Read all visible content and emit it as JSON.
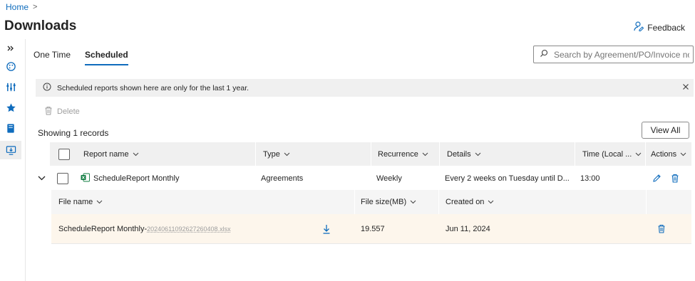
{
  "breadcrumb": {
    "home": "Home",
    "sep": ">"
  },
  "page": {
    "title": "Downloads"
  },
  "feedback": {
    "label": "Feedback"
  },
  "tabs": [
    {
      "label": "One Time"
    },
    {
      "label": "Scheduled"
    }
  ],
  "search": {
    "placeholder": "Search by Agreement/PO/Invoice no., ..."
  },
  "info": {
    "message": "Scheduled reports shown here are only for the last 1 year."
  },
  "toolbar": {
    "delete_label": "Delete",
    "records_label": "Showing 1 records",
    "view_all_label": "View All"
  },
  "grid": {
    "columns": {
      "report_name": "Report name",
      "type": "Type",
      "recurrence": "Recurrence",
      "details": "Details",
      "time": "Time (Local ...",
      "actions": "Actions"
    },
    "row": {
      "report_name": "ScheduleReport Monthly",
      "type": "Agreements",
      "recurrence": "Weekly",
      "details": "Every 2 weeks on Tuesday until D...",
      "time": "13:00"
    }
  },
  "subgrid": {
    "columns": {
      "file_name": "File name",
      "file_size": "File size(MB)",
      "created_on": "Created on"
    },
    "row": {
      "file_name": "ScheduleReport Monthly-",
      "file_name_tail": "20240611092627260408.xlsx",
      "file_size": "19.557",
      "created_on": "Jun 11, 2024"
    }
  },
  "colors": {
    "accent": "#0f6cbd",
    "excel_green": "#107c41",
    "info_bg": "#f0f0f0",
    "row_highlight": "#fdf6ec"
  },
  "icons": [
    "expand-icon",
    "palette-icon",
    "filters-icon",
    "star-icon",
    "book-icon",
    "download-screen-icon",
    "search-icon",
    "info-icon",
    "close-icon",
    "trash-icon",
    "edit-icon",
    "download-icon",
    "excel-icon",
    "chevron-down-icon",
    "feedback-icon"
  ]
}
